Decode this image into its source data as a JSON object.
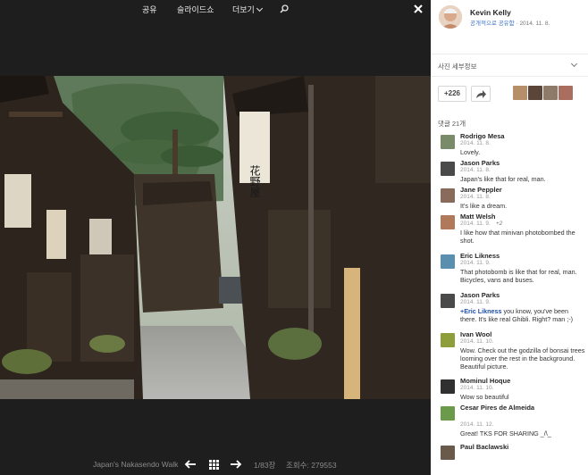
{
  "toolbar": {
    "share_label": "공유",
    "slideshow_label": "슬라이드쇼",
    "more_label": "더보기"
  },
  "photo": {
    "description_icons": [
      "search-icon",
      "close-icon"
    ],
    "sign_text": "花野屋"
  },
  "footer": {
    "album_caption": "Japan's Nakasendo Walk",
    "counter": "1/83장",
    "views_label": "조회수:",
    "views_value": "279553"
  },
  "owner": {
    "name": "Kevin Kelly",
    "visibility": "공개적으로 공유함",
    "date": "· 2014. 11. 8."
  },
  "details": {
    "label": "사진 세부정보"
  },
  "plus_one": {
    "label": "+226"
  },
  "comments_header": "댓글 21개",
  "comments": [
    {
      "name": "Rodrigo Mesa",
      "date": "2014. 11. 8.",
      "plus": "",
      "mention": "",
      "text": "Lovely.",
      "color": "#7a8b6a"
    },
    {
      "name": "Jason Parks",
      "date": "2014. 11. 8.",
      "plus": "",
      "mention": "",
      "text": "Japan's like that for real, man.",
      "color": "#4a4a4a"
    },
    {
      "name": "Jane Peppler",
      "date": "2014. 11. 8.",
      "plus": "",
      "mention": "",
      "text": "It's like a dream.",
      "color": "#8a6a5a"
    },
    {
      "name": "Matt Welsh",
      "date": "2014. 11. 9.",
      "plus": "+2",
      "mention": "",
      "text": "I like how that minivan photobombed the shot.",
      "color": "#b07a5a"
    },
    {
      "name": "Eric Likness",
      "date": "2014. 11. 9.",
      "plus": "",
      "mention": "",
      "text": "That photobomb is like that for real, man. Bicycles, vans and buses.",
      "color": "#5a8fb0"
    },
    {
      "name": "Jason Parks",
      "date": "2014. 11. 9.",
      "plus": "",
      "mention": "+Eric Likness",
      "text": " you know, you've been there. It's like real Ghibli. Right? man ;-)",
      "color": "#4a4a4a"
    },
    {
      "name": "Ivan Wool",
      "date": "2014. 11. 10.",
      "plus": "",
      "mention": "",
      "text": "Wow. Check out the godzilla of bonsai trees looming over the rest in the background. Beautiful picture.",
      "color": "#8e9e3a"
    },
    {
      "name": "Mominul Hoque",
      "date": "2014. 11. 10.",
      "plus": "",
      "mention": "",
      "text": "Wow so beautiful",
      "color": "#303030"
    },
    {
      "name": "Cesar Pires de Almeida",
      "date": "2014. 11. 12.",
      "plus": "",
      "mention": "",
      "text": "Great! TKS FOR SHARING _/\\_",
      "color": "#6a9a4a"
    },
    {
      "name": "Paul Baclawski",
      "date": "",
      "plus": "",
      "mention": "",
      "text": "",
      "color": "#6a5a4a"
    }
  ]
}
